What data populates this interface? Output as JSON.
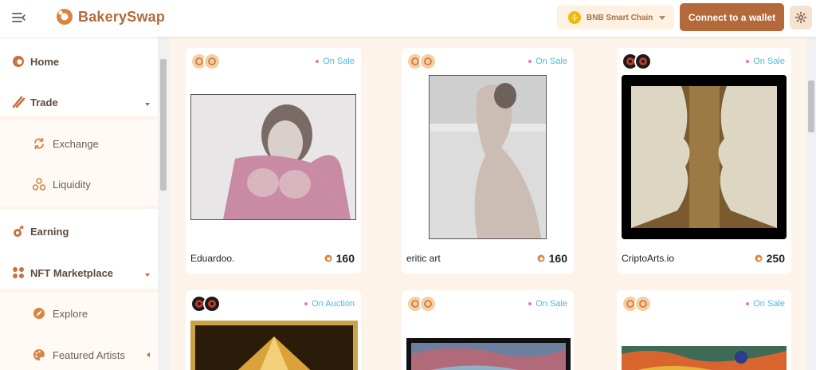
{
  "header": {
    "brand": "BakerySwap",
    "chain_label": "BNB Smart Chain",
    "connect_label": "Connect to a wallet"
  },
  "sidebar": {
    "items": [
      {
        "label": "Home",
        "icon": "home-icon"
      },
      {
        "label": "Trade",
        "icon": "trade-icon"
      },
      {
        "label": "Exchange",
        "icon": "exchange-icon"
      },
      {
        "label": "Liquidity",
        "icon": "liquidity-icon"
      },
      {
        "label": "Earning",
        "icon": "earning-icon"
      },
      {
        "label": "NFT Marketplace",
        "icon": "nft-marketplace-icon"
      },
      {
        "label": "Explore",
        "icon": "explore-icon"
      },
      {
        "label": "Featured Artists",
        "icon": "palette-icon"
      }
    ]
  },
  "cards": [
    {
      "name": "Eduardoo.",
      "status": "On Sale",
      "price": "160",
      "avatar": "bread"
    },
    {
      "name": "eritic art",
      "status": "On Sale",
      "price": "160",
      "avatar": "bread"
    },
    {
      "name": "CriptoArts.io",
      "status": "On Sale",
      "price": "250",
      "avatar": "dark"
    },
    {
      "name": "",
      "status": "On Auction",
      "price": "",
      "avatar": "dark"
    },
    {
      "name": "",
      "status": "On Sale",
      "price": "",
      "avatar": "bread"
    },
    {
      "name": "",
      "status": "On Sale",
      "price": "",
      "avatar": "bread"
    }
  ],
  "colors": {
    "brand": "#b4693b",
    "status_text": "#4fb8e4",
    "status_dot": "#d57cc9",
    "main_bg": "#fdf3e8"
  }
}
